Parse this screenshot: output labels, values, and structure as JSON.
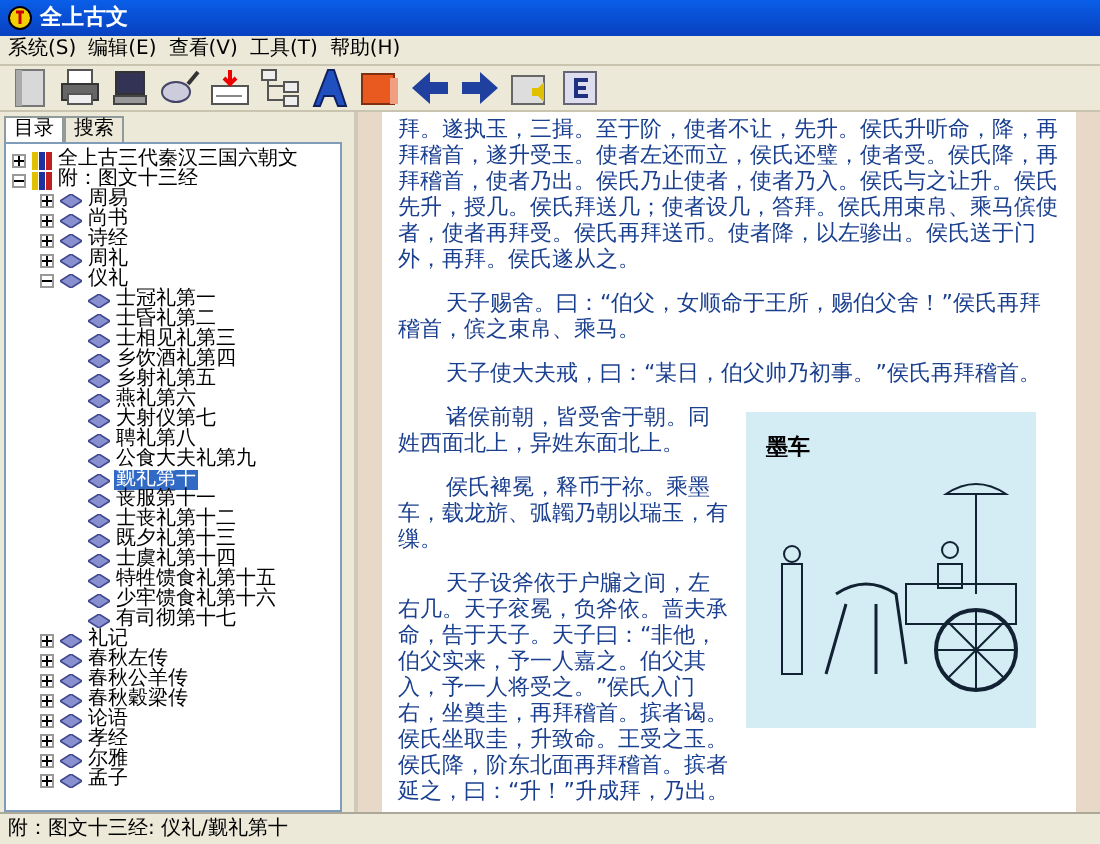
{
  "window": {
    "title": "全上古文"
  },
  "menu": [
    "系统(S)",
    "编辑(E)",
    "查看(V)",
    "工具(T)",
    "帮助(H)"
  ],
  "toolbar": [
    {
      "kind": "book"
    },
    {
      "kind": "printer"
    },
    {
      "kind": "monitor"
    },
    {
      "kind": "magnifier"
    },
    {
      "kind": "card"
    },
    {
      "kind": "tree"
    },
    {
      "kind": "font"
    },
    {
      "kind": "folder"
    },
    {
      "kind": "back"
    },
    {
      "kind": "forward"
    },
    {
      "kind": "speaker"
    },
    {
      "kind": "e"
    }
  ],
  "tabs": [
    {
      "label": "目录",
      "selected": true
    },
    {
      "label": "搜索",
      "selected": false
    }
  ],
  "tree": [
    {
      "label": "全上古三代秦汉三国六朝文",
      "expanded": false,
      "kind": "book"
    },
    {
      "label": "附：图文十三经",
      "expanded": true,
      "kind": "book",
      "children": [
        {
          "label": "周易",
          "expanded": false
        },
        {
          "label": "尚书",
          "expanded": false
        },
        {
          "label": "诗经",
          "expanded": false
        },
        {
          "label": "周礼",
          "expanded": false
        },
        {
          "label": "仪礼",
          "expanded": true,
          "children": [
            {
              "label": "士冠礼第一",
              "selected": false
            },
            {
              "label": "士昏礼第二",
              "selected": false
            },
            {
              "label": "士相见礼第三",
              "selected": false
            },
            {
              "label": "乡饮酒礼第四",
              "selected": false
            },
            {
              "label": "乡射礼第五",
              "selected": false
            },
            {
              "label": "燕礼第六",
              "selected": false
            },
            {
              "label": "大射仪第七",
              "selected": false
            },
            {
              "label": "聘礼第八",
              "selected": false
            },
            {
              "label": "公食大夫礼第九",
              "selected": false
            },
            {
              "label": "觐礼第十",
              "selected": true
            },
            {
              "label": "丧服第十一",
              "selected": false
            },
            {
              "label": "士丧礼第十二",
              "selected": false
            },
            {
              "label": "既夕礼第十三",
              "selected": false
            },
            {
              "label": "士虞礼第十四",
              "selected": false
            },
            {
              "label": "特牲馈食礼第十五",
              "selected": false
            },
            {
              "label": "少牢馈食礼第十六",
              "selected": false
            },
            {
              "label": "有司彻第十七",
              "selected": false
            }
          ]
        },
        {
          "label": "礼记",
          "expanded": false
        },
        {
          "label": "春秋左传",
          "expanded": false
        },
        {
          "label": "春秋公羊传",
          "expanded": false
        },
        {
          "label": "春秋穀梁传",
          "expanded": false
        },
        {
          "label": "论语",
          "expanded": false
        },
        {
          "label": "孝经",
          "expanded": false
        },
        {
          "label": "尔雅",
          "expanded": false
        },
        {
          "label": "孟子",
          "expanded": false
        }
      ]
    }
  ],
  "content": {
    "paragraphs": [
      {
        "kind": "continuation",
        "text": "拜。遂执玉，三揖。至于阶，使者不让，先升。侯氏升听命，降，再拜稽首，遂升受玉。使者左还而立，侯氏还璧，使者受。侯氏降，再拜稽首，使者乃出。侯氏乃止使者，使者乃入。侯氏与之让升。侯氏先升，授几。侯氏拜送几；使者设几，答拜。侯氏用束帛、乘马傧使者，使者再拜受。侯氏再拜送币。使者降，以左骖出。侯氏送于门外，再拜。侯氏遂从之。"
      },
      {
        "kind": "paragraph",
        "text": "天子赐舍。曰：“伯父，女顺命于王所，赐伯父舍！”侯氏再拜稽首，傧之束帛、乘马。"
      },
      {
        "kind": "paragraph",
        "text": "天子使大夫戒，曰：“某日，伯父帅乃初事。”侯氏再拜稽首。"
      }
    ],
    "side_paragraphs": [
      {
        "kind": "paragraph",
        "text": "诸侯前朝，皆受舍于朝。同姓西面北上，异姓东面北上。"
      },
      {
        "kind": "paragraph",
        "text": "侯氏裨冕，释币于祢。乘墨车，载龙旂、弧韣乃朝以瑞玉，有缫。"
      },
      {
        "kind": "paragraph",
        "text": "天子设斧依于户牖之间，左右几。天子衮冕，负斧依。啬夫承命，告于天子。天子曰：“非他，伯父实来，予一人嘉之。伯父其入，予一人将受之。”侯氏入门右，坐奠圭，再拜稽首。摈者谒。侯氏坐取圭，升致命。王受之玉。侯氏降，阶东北面再拜稽首。摈者延之，曰：“升！”升成拜，乃出。"
      }
    ],
    "figure": {
      "caption": "墨车"
    }
  },
  "status_bar": "附：图文十三经: 仪礼/觐礼第十"
}
